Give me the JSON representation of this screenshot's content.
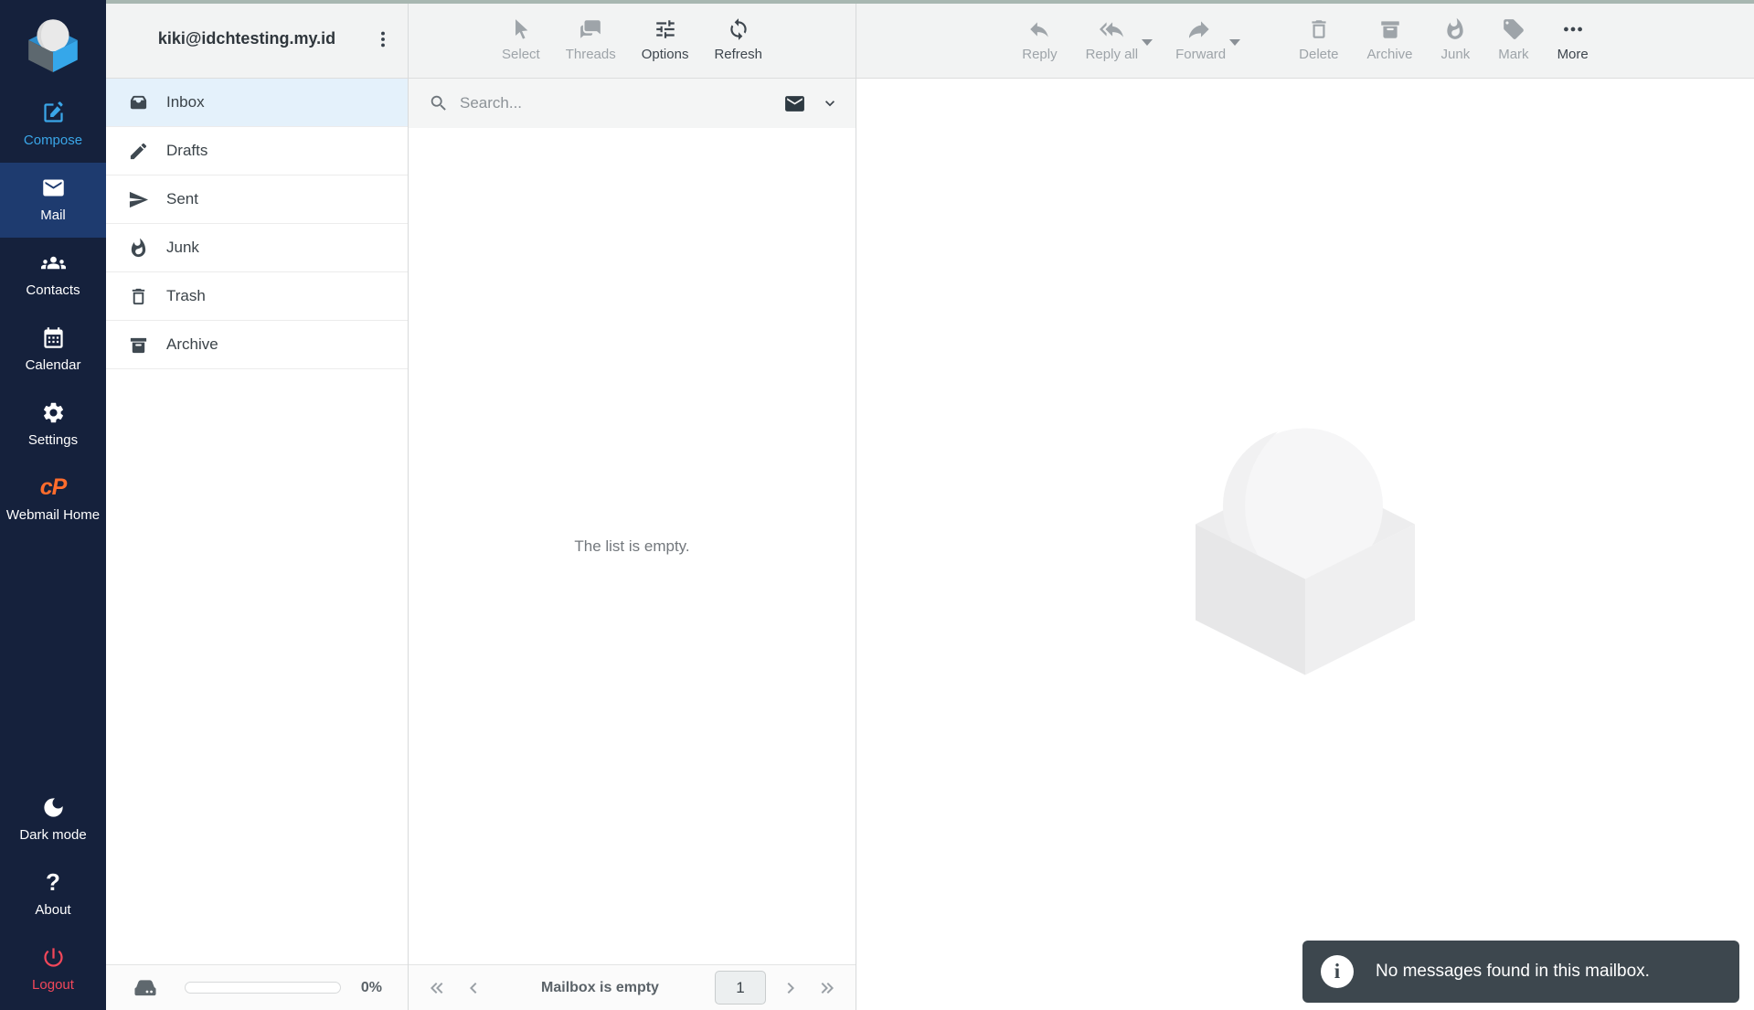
{
  "colors": {
    "sidebar_bg": "#15213c",
    "sidebar_active_bg": "#1e3b6f",
    "accent_blue": "#3aa6e8",
    "logout_red": "#f2475a",
    "cpanel_orange": "#ff6c2c",
    "toolbar_bg": "#f2f3f3",
    "selected_row_bg": "#e4f1fb",
    "toast_bg": "#3d474e",
    "top_strip": "#a8b7b1"
  },
  "sidebar": {
    "items": [
      {
        "label": "Compose"
      },
      {
        "label": "Mail",
        "active": true
      },
      {
        "label": "Contacts"
      },
      {
        "label": "Calendar"
      },
      {
        "label": "Settings"
      },
      {
        "label": "Webmail Home"
      },
      {
        "label": "Dark mode"
      },
      {
        "label": "About"
      },
      {
        "label": "Logout"
      }
    ]
  },
  "mailbox_panel": {
    "account_email": "kiki@idchtesting.my.id",
    "folders": [
      {
        "label": "Inbox",
        "selected": true
      },
      {
        "label": "Drafts"
      },
      {
        "label": "Sent"
      },
      {
        "label": "Junk"
      },
      {
        "label": "Trash"
      },
      {
        "label": "Archive"
      }
    ],
    "storage_percent": "0%"
  },
  "list_panel": {
    "toolbar": {
      "select": "Select",
      "threads": "Threads",
      "options": "Options",
      "refresh": "Refresh"
    },
    "search_placeholder": "Search...",
    "empty_message": "The list is empty.",
    "footer_status": "Mailbox is empty",
    "page_number": "1"
  },
  "message_panel": {
    "toolbar": {
      "reply": "Reply",
      "reply_all": "Reply all",
      "forward": "Forward",
      "delete": "Delete",
      "archive": "Archive",
      "junk": "Junk",
      "mark": "Mark",
      "more": "More"
    }
  },
  "toast": {
    "message": "No messages found in this mailbox."
  }
}
